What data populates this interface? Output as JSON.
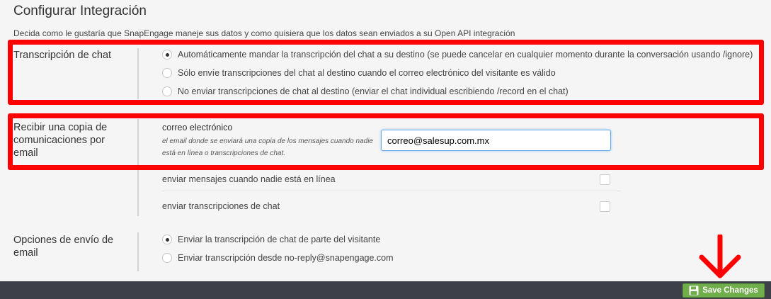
{
  "header": {
    "title": "Configurar Integración",
    "description": "Decida como le gustaría que SnapEngage maneje sus datos y como quisiera que los datos sean enviados a su Open API integración"
  },
  "transcript_section": {
    "label": "Transcripción de chat",
    "options": [
      {
        "label": "Automáticamente mandar la transcripción del chat a su destino (se puede cancelar en cualquier momento durante la conversación usando /ignore)",
        "selected": true
      },
      {
        "label": "Sólo envíe transcripciones del chat al destino cuando el correo electrónico del visitante es válido",
        "selected": false
      },
      {
        "label": "No enviar transcripciones de chat al destino (enviar el chat individual escribiendo /record en el chat)",
        "selected": false
      }
    ]
  },
  "copy_section": {
    "label": "Recibir una copia de comunicaciones por email",
    "email_label": "correo electrónico",
    "email_help": "el email donde se enviará una copia de los mensajes cuando nadie está en línea o transcripciones de chat.",
    "email_value": "correo@salesup.com.mx",
    "checkboxes": [
      {
        "label": "enviar mensajes cuando nadie está en línea",
        "checked": false
      },
      {
        "label": "enviar transcripciones de chat",
        "checked": false
      }
    ]
  },
  "send_section": {
    "label": "Opciones de envío de email",
    "options": [
      {
        "label": "Enviar la transcripción de chat de parte del visitante",
        "selected": true
      },
      {
        "label": "Enviar transcripción desde no-reply@snapengage.com",
        "selected": false
      }
    ]
  },
  "footer": {
    "save_label": "Save Changes",
    "save_icon": "floppy-disk-icon"
  },
  "colors": {
    "annotation": "#ff0000",
    "save_button": "#6fae4a",
    "footer": "#3d4047",
    "focus_border": "#6aa9e6"
  }
}
